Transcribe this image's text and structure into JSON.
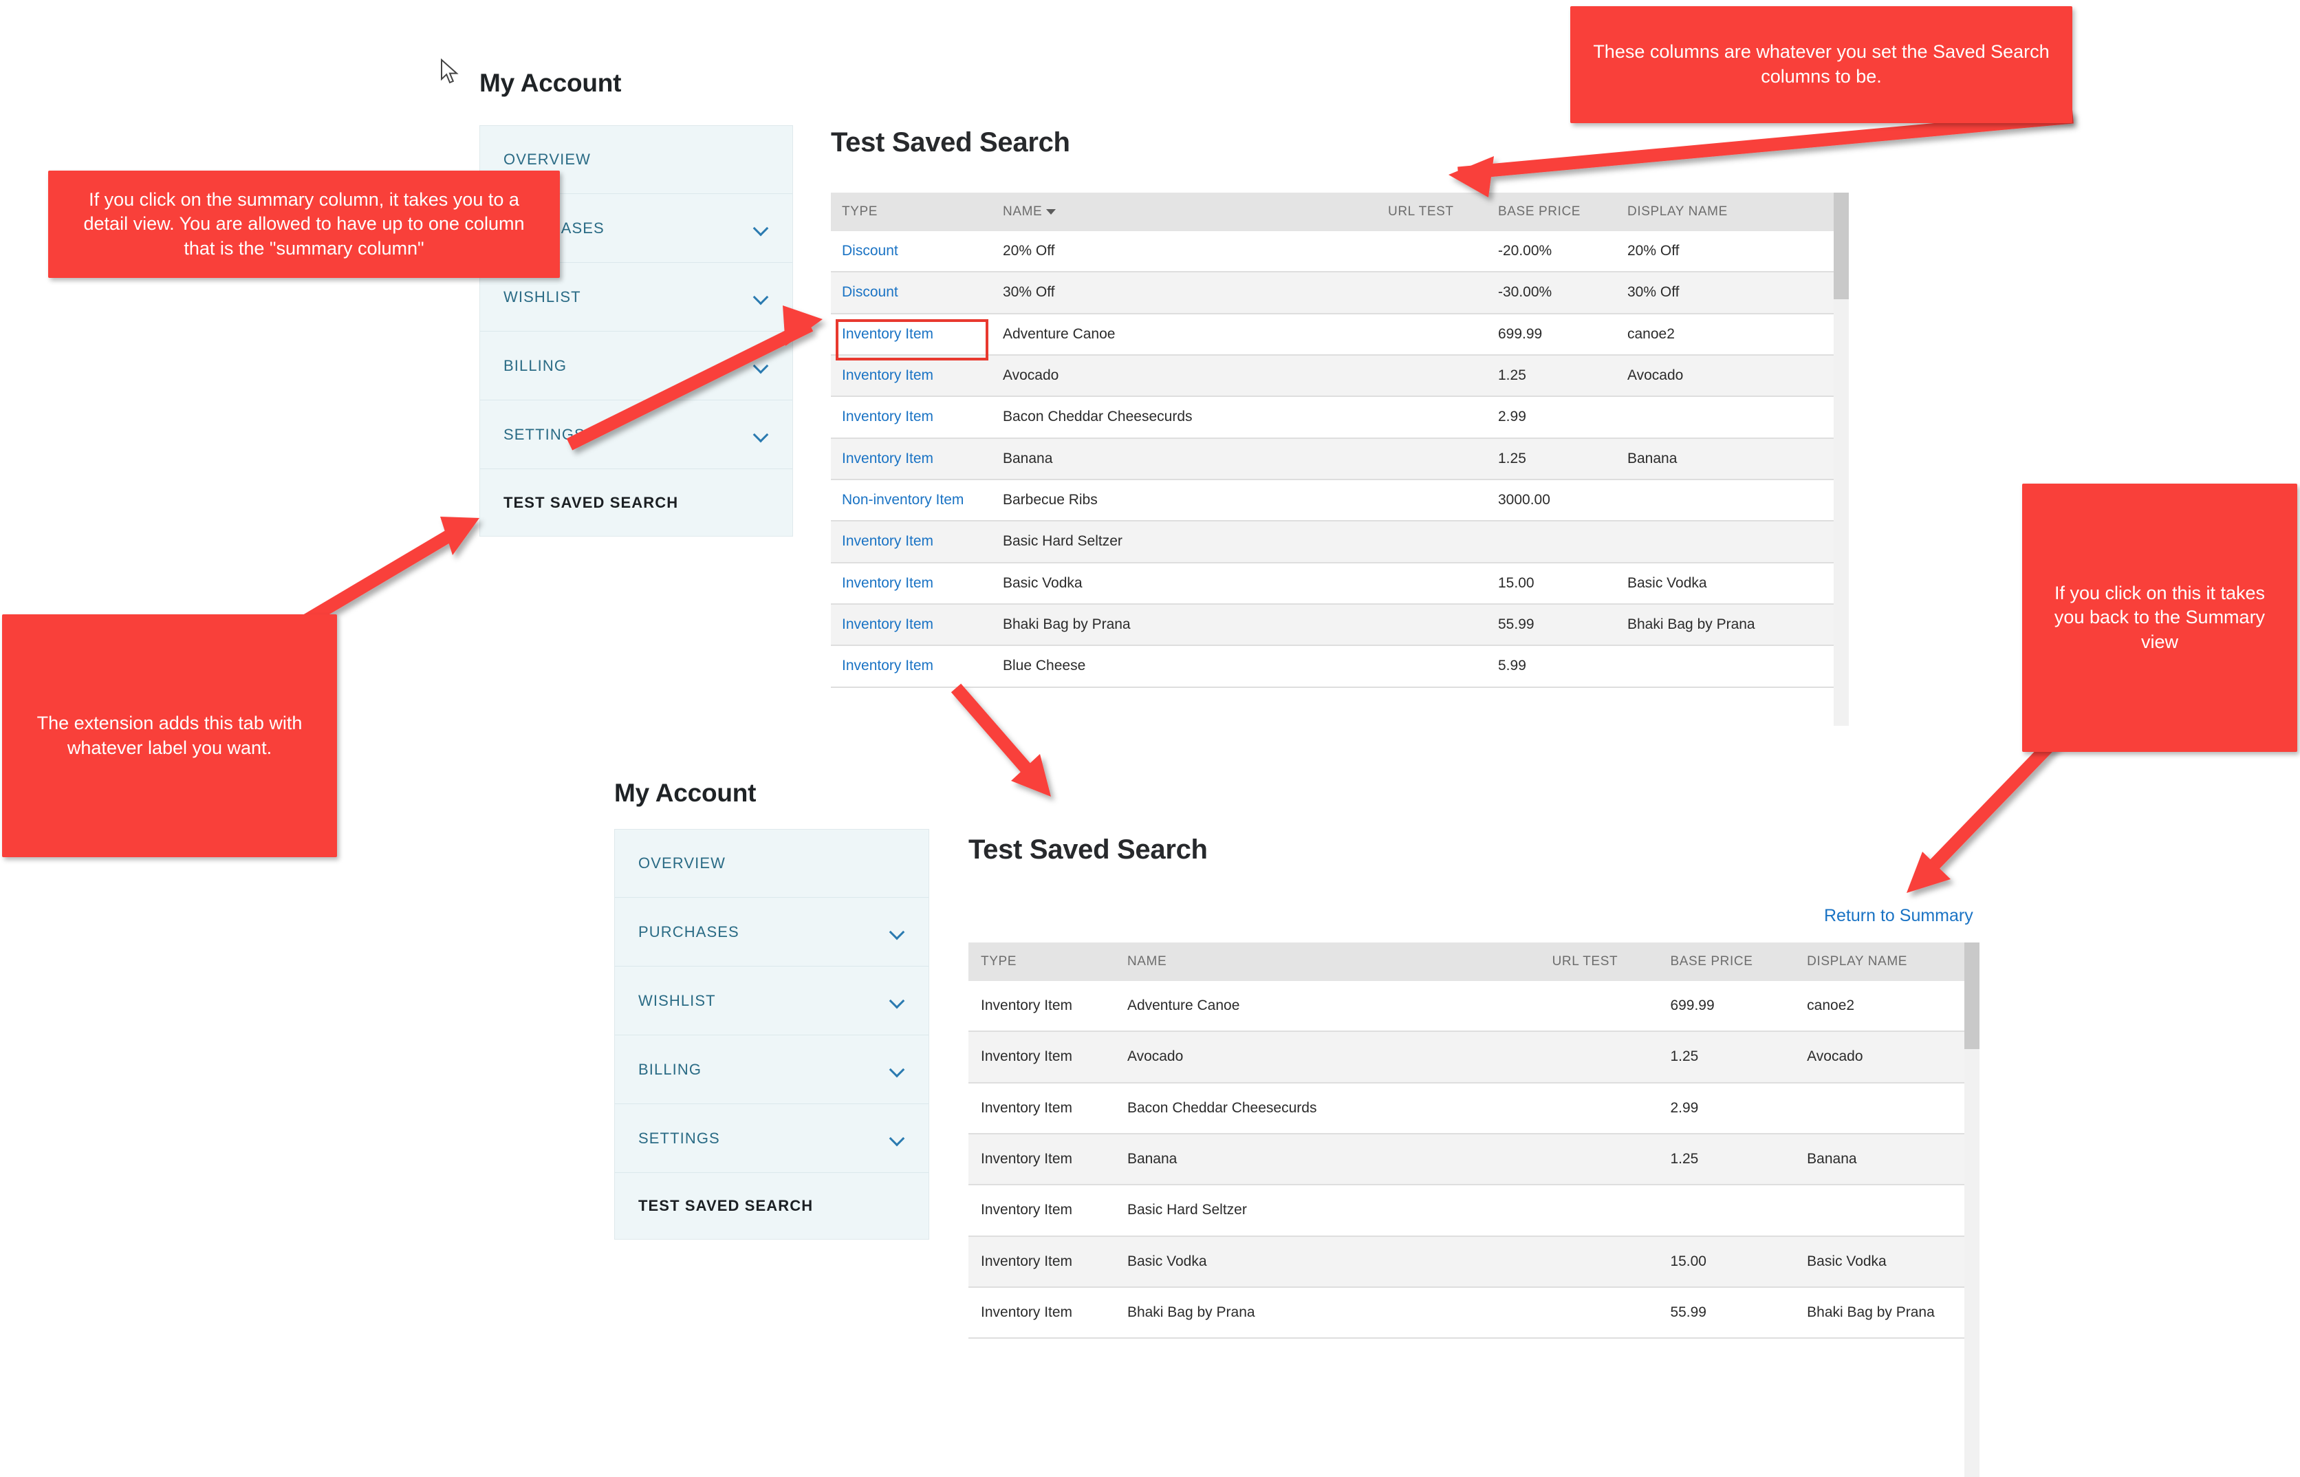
{
  "summary_view": {
    "page_title": "My Account",
    "sidebar": {
      "items": [
        {
          "label": "OVERVIEW",
          "chevron": false,
          "active": false
        },
        {
          "label": "PURCHASES",
          "chevron": true,
          "active": false
        },
        {
          "label": "WISHLIST",
          "chevron": true,
          "active": false
        },
        {
          "label": "BILLING",
          "chevron": true,
          "active": false
        },
        {
          "label": "SETTINGS",
          "chevron": true,
          "active": false
        },
        {
          "label": "TEST SAVED SEARCH",
          "chevron": false,
          "active": true
        }
      ]
    },
    "section_title": "Test Saved Search",
    "table": {
      "columns": [
        "TYPE",
        "NAME",
        "URL TEST",
        "BASE PRICE",
        "DISPLAY NAME"
      ],
      "sorted_column": "NAME",
      "sort_direction": "desc",
      "rows": [
        {
          "type": "Discount",
          "name": "20% Off",
          "url_test": "",
          "base_price": "-20.00%",
          "display_name": "20% Off"
        },
        {
          "type": "Discount",
          "name": "30% Off",
          "url_test": "",
          "base_price": "-30.00%",
          "display_name": "30% Off"
        },
        {
          "type": "Inventory Item",
          "name": "Adventure Canoe",
          "url_test": "",
          "base_price": "699.99",
          "display_name": "canoe2"
        },
        {
          "type": "Inventory Item",
          "name": "Avocado",
          "url_test": "",
          "base_price": "1.25",
          "display_name": "Avocado"
        },
        {
          "type": "Inventory Item",
          "name": "Bacon Cheddar Cheesecurds",
          "url_test": "",
          "base_price": "2.99",
          "display_name": ""
        },
        {
          "type": "Inventory Item",
          "name": "Banana",
          "url_test": "",
          "base_price": "1.25",
          "display_name": "Banana"
        },
        {
          "type": "Non-inventory Item",
          "name": "Barbecue Ribs",
          "url_test": "",
          "base_price": "3000.00",
          "display_name": ""
        },
        {
          "type": "Inventory Item",
          "name": "Basic Hard Seltzer",
          "url_test": "",
          "base_price": "",
          "display_name": ""
        },
        {
          "type": "Inventory Item",
          "name": "Basic Vodka",
          "url_test": "",
          "base_price": "15.00",
          "display_name": "Basic Vodka"
        },
        {
          "type": "Inventory Item",
          "name": "Bhaki Bag by Prana",
          "url_test": "",
          "base_price": "55.99",
          "display_name": "Bhaki Bag by Prana"
        },
        {
          "type": "Inventory Item",
          "name": "Blue Cheese",
          "url_test": "",
          "base_price": "5.99",
          "display_name": ""
        }
      ]
    }
  },
  "detail_view": {
    "page_title": "My Account",
    "sidebar": {
      "items": [
        {
          "label": "OVERVIEW",
          "chevron": false,
          "active": false
        },
        {
          "label": "PURCHASES",
          "chevron": true,
          "active": false
        },
        {
          "label": "WISHLIST",
          "chevron": true,
          "active": false
        },
        {
          "label": "BILLING",
          "chevron": true,
          "active": false
        },
        {
          "label": "SETTINGS",
          "chevron": true,
          "active": false
        },
        {
          "label": "TEST SAVED SEARCH",
          "chevron": false,
          "active": true
        }
      ]
    },
    "section_title": "Test Saved Search",
    "return_link": "Return to Summary",
    "table": {
      "columns": [
        "TYPE",
        "NAME",
        "URL TEST",
        "BASE PRICE",
        "DISPLAY NAME"
      ],
      "rows": [
        {
          "type": "Inventory Item",
          "name": "Adventure Canoe",
          "url_test": "",
          "base_price": "699.99",
          "display_name": "canoe2"
        },
        {
          "type": "Inventory Item",
          "name": "Avocado",
          "url_test": "",
          "base_price": "1.25",
          "display_name": "Avocado"
        },
        {
          "type": "Inventory Item",
          "name": "Bacon Cheddar Cheesecurds",
          "url_test": "",
          "base_price": "2.99",
          "display_name": ""
        },
        {
          "type": "Inventory Item",
          "name": "Banana",
          "url_test": "",
          "base_price": "1.25",
          "display_name": "Banana"
        },
        {
          "type": "Inventory Item",
          "name": "Basic Hard Seltzer",
          "url_test": "",
          "base_price": "",
          "display_name": ""
        },
        {
          "type": "Inventory Item",
          "name": "Basic Vodka",
          "url_test": "",
          "base_price": "15.00",
          "display_name": "Basic Vodka"
        },
        {
          "type": "Inventory Item",
          "name": "Bhaki Bag by Prana",
          "url_test": "",
          "base_price": "55.99",
          "display_name": "Bhaki Bag by Prana"
        }
      ]
    }
  },
  "annotations": [
    {
      "id": "columns-note",
      "text": "These columns are whatever you set the Saved Search columns to be."
    },
    {
      "id": "summary-column-note",
      "text": "If you click on the summary column, it takes you to a detail view.  You are allowed to have up to one column that is the \"summary column\""
    },
    {
      "id": "extension-tab-note",
      "text": "The extension adds this tab with whatever label you want."
    },
    {
      "id": "return-summary-note",
      "text": "If you click on this it takes you back to the Summary view"
    }
  ],
  "colors": {
    "callout_red": "#f9403a",
    "link_blue": "#1a73c4",
    "sidebar_bg": "#eef6f8",
    "table_header_bg": "#e4e4e4"
  }
}
